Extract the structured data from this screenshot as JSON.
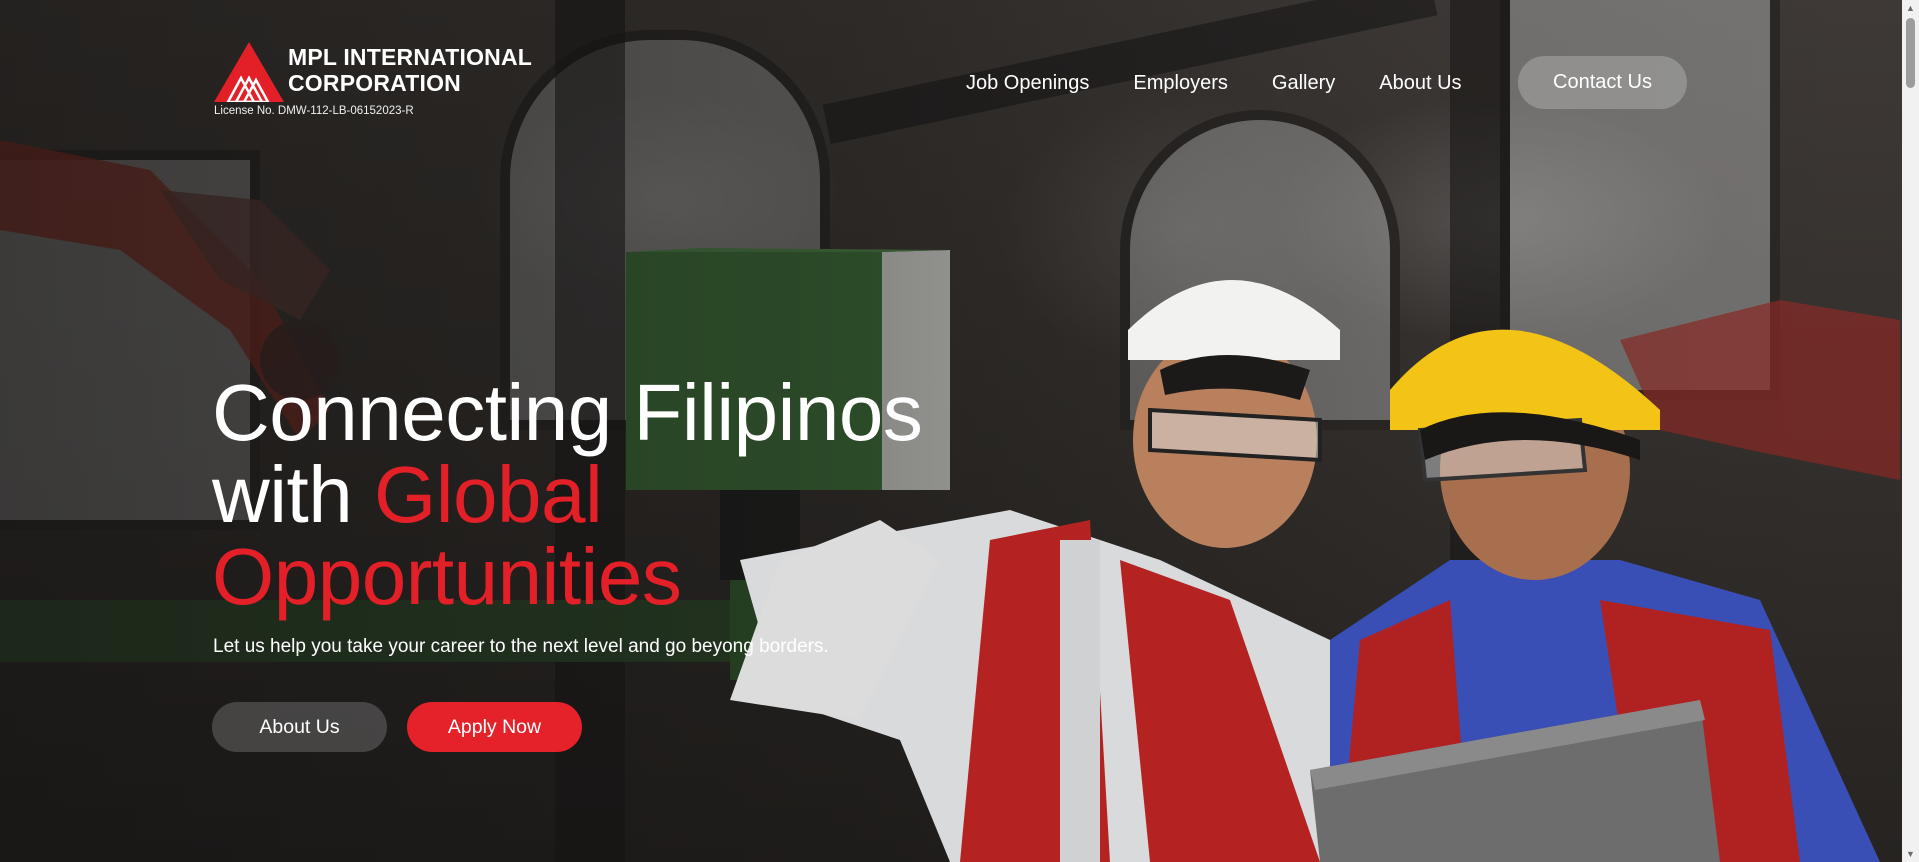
{
  "brand": {
    "line1": "MPL INTERNATIONAL",
    "line2": "CORPORATION",
    "license": "License No. DMW-112-LB-06152023-R",
    "accent_color": "#e32028"
  },
  "nav": {
    "items": [
      "Job Openings",
      "Employers",
      "Gallery",
      "About Us"
    ],
    "contact_label": "Contact Us"
  },
  "hero": {
    "headline_line1": "Connecting Filipinos",
    "headline_with": "with",
    "headline_highlight1": "Global",
    "headline_highlight2": "Opportunities",
    "subtitle": "Let us help you take your career to the next level and go beyong borders.",
    "about_label": "About Us",
    "apply_label": "Apply Now"
  },
  "icons": {
    "logo": "triangle-logo-icon",
    "scroll_up": "scroll-up-arrow-icon",
    "scroll_down": "scroll-down-arrow-icon"
  }
}
